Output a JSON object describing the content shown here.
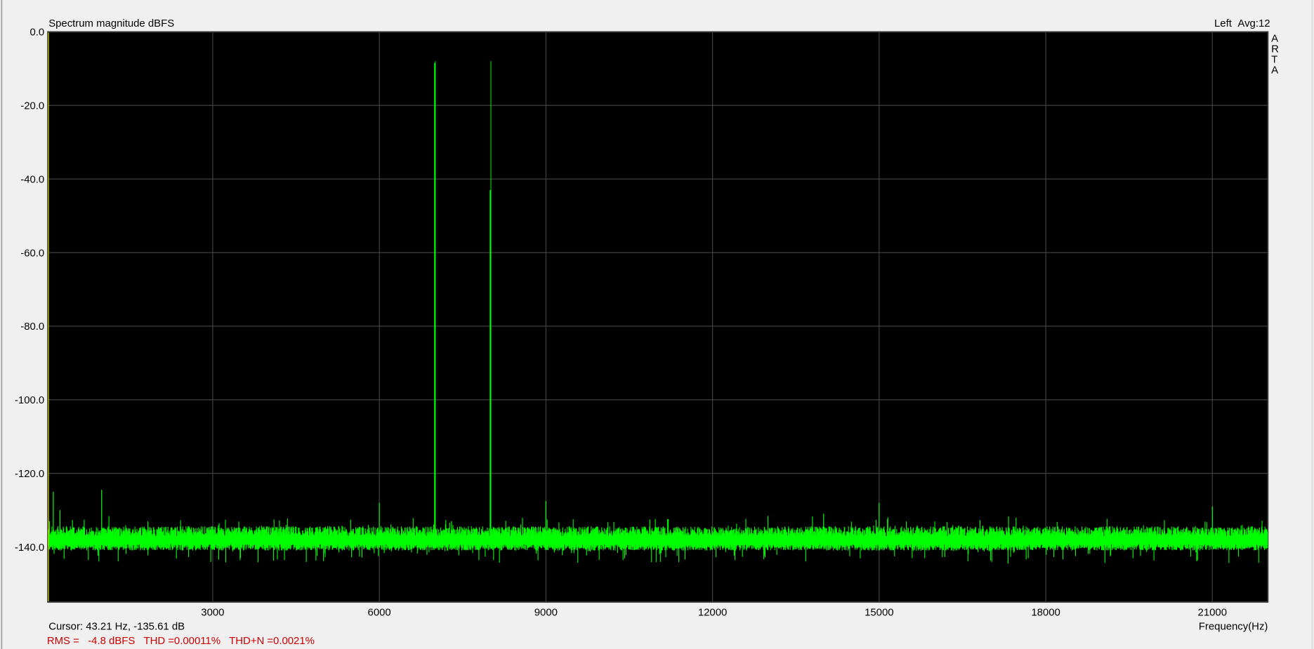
{
  "chart_data": {
    "type": "line",
    "title": "Spectrum magnitude dBFS",
    "channel_label": "Left",
    "avg_label": "Avg:12",
    "brand_letters": [
      "A",
      "R",
      "T",
      "A"
    ],
    "xlabel": "Frequency(Hz)",
    "ylabel": "dBFS",
    "xlim": [
      30,
      22000
    ],
    "ylim": [
      -155,
      0
    ],
    "x_ticks": [
      3000,
      6000,
      9000,
      12000,
      15000,
      18000,
      21000
    ],
    "x_tick_labels": [
      "3000",
      "6000",
      "9000",
      "12000",
      "15000",
      "18000",
      "21000"
    ],
    "y_ticks": [
      0,
      -20,
      -40,
      -60,
      -80,
      -100,
      -120,
      -140
    ],
    "y_tick_labels": [
      "0.0",
      "-20.0",
      "-40.0",
      "-60.0",
      "-80.0",
      "-100.0",
      "-120.0",
      "-140.0"
    ],
    "grid": true,
    "noise_floor": {
      "mean_db": -138,
      "spread_db": 3,
      "min_db": -145
    },
    "peaks": [
      {
        "freq": 7000,
        "db": -8.0,
        "main_db": -8.5
      },
      {
        "freq": 8000,
        "db": -8.0,
        "main_db": -43.0
      }
    ],
    "spurs": [
      {
        "freq": 60,
        "db": -133
      },
      {
        "freq": 130,
        "db": -125
      },
      {
        "freq": 250,
        "db": -130
      },
      {
        "freq": 1000,
        "db": -124.5
      },
      {
        "freq": 6000,
        "db": -128
      },
      {
        "freq": 7300,
        "db": -133
      },
      {
        "freq": 9000,
        "db": -127.5
      },
      {
        "freq": 14000,
        "db": -131
      },
      {
        "freq": 15000,
        "db": -128
      },
      {
        "freq": 21000,
        "db": -129
      }
    ],
    "cursor_freq": 43.21,
    "colors": {
      "trace": "#00ff00",
      "grid": "#404040",
      "cursor": "#c8c800",
      "background": "#000000",
      "stats": "#cc0000"
    }
  },
  "status": {
    "cursor": "Cursor: 43.21 Hz, -135.61 dB",
    "stats": "RMS =   -4.8 dBFS   THD =0.00011%   THD+N =0.0021%"
  }
}
